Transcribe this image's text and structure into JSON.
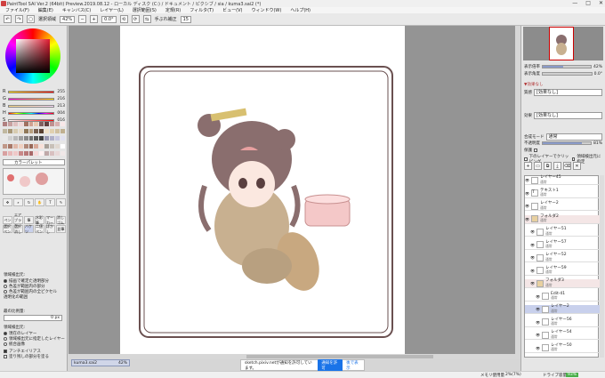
{
  "window": {
    "title": "PaintTool SAI Ver.2 (64bit) Preview.2019.08.12 - ローカル ディスク (C:) / ドキュメント / ピクシブ / sia / kuma3.sai2 (*)",
    "controls": [
      "—",
      "□",
      "✕"
    ]
  },
  "menu": [
    "ファイル(F)",
    "編集(E)",
    "キャンバス(C)",
    "レイヤー(L)",
    "選択範囲(S)",
    "定規(R)",
    "フィルタ(T)",
    "ビュー(V)",
    "ウィンドウ(W)",
    "ヘルプ(H)"
  ],
  "toolbar": {
    "selection_label": "選択領域",
    "zoom": "42%",
    "rotation": "0.0°",
    "stabilizer_label": "手ぶれ補正",
    "stabilizer_value": "15"
  },
  "color": {
    "hsv_labels": [
      "R",
      "G",
      "B",
      "H",
      "S",
      "V"
    ],
    "hsv_values": [
      "255",
      "216",
      "213",
      "004",
      "016",
      "100"
    ],
    "swatch_colors": [
      "#b08080",
      "#c8a0a0",
      "#e0c0c0",
      "#f0d8d8",
      "#a07060",
      "#d0a090",
      "#e8c8b0",
      "#806060",
      "#604040",
      "#c09090",
      "#d8b0b0",
      "#f8e8e8",
      "#c0b8a0",
      "#a89878",
      "#d8ccb0",
      "#e8dcc8",
      "#907858",
      "#b8a080",
      "#786050",
      "#584030",
      "#f0e0c8",
      "#e0d0b0",
      "#d0c0a0",
      "#c0b090",
      "#e8e8e8",
      "#d0d0d0",
      "#b8b8b8",
      "#a0a0a0",
      "#888888",
      "#707070",
      "#585858",
      "#404040",
      "#9898b0",
      "#b0b0c8",
      "#c8c8e0",
      "#e0e0f0",
      "#c09888",
      "#a87868",
      "#e0b8a8",
      "#f0d0c0",
      "#b08878",
      "#986858",
      "#d8a898",
      "#f8e0d8",
      "#a8a098",
      "#c8c0b8",
      "#e0d8d0",
      "#ffffff",
      "#d8a0a0",
      "#e8b8b8",
      "#f0c8c8",
      "#c88888",
      "#b87878",
      "#a86868",
      "#f8d8d8",
      "#fff0f0",
      "#c0a8a8",
      "#d8c0c0",
      "#e8d8d8",
      "#f0e8e8"
    ]
  },
  "tools": {
    "palette_mode": "カラーパレット",
    "brush_labels": [
      "ペン",
      "エアブラシ",
      "筆",
      "水彩筆",
      "マーカー",
      "消しゴム",
      "選択ペン",
      "選択消し",
      "バケツ",
      "二値ペン",
      "ぼかし",
      "鉛筆"
    ],
    "detect_label": "領域検出元:",
    "detect_options": [
      "描画で確定た透明部分",
      "色差が範囲内の部分",
      "色差が範囲内の全ピクセル"
    ],
    "detect_extra": "透明化の範囲",
    "spread_label": "最の比例量:",
    "spread_value": "0 px",
    "target_label": "領域検出元:",
    "target_options": [
      "現在のレイヤー",
      "領域検出元に指定したレイヤー",
      "統合画像"
    ],
    "aa_label": "アンチエイリアス",
    "aa_extra": "塗り残しの部分を塗る"
  },
  "statusbar": {
    "file_tab": "kuma3.sai2",
    "file_zoom": "42%",
    "notif_text": "sketch.pixiv.netが通知を許可しています。",
    "notif_allow": "通知を許可",
    "notif_later": "後で表示",
    "memory": "メモリ使用量",
    "memory_value": "2%(7%)",
    "drive": "ドライブ容量",
    "drive_value": "93%"
  },
  "right": {
    "zoom_label": "表示倍率",
    "zoom_value": "42%",
    "angle_label": "表示角度",
    "angle_value": "0.0°",
    "effect_header": "▼効果なし",
    "texture_label": "質感",
    "texture_value": "[効果なし]",
    "effect_label": "効果",
    "effect_value": "[効果なし]",
    "blend_label": "合成モード",
    "blend_value": "通常",
    "opacity_label": "不透明度",
    "opacity_value": "81%",
    "opacity_fraction": 0.81,
    "protect_label": "保護",
    "clip_label": "下のレイヤーでクリッピング",
    "ref_label": "領域検出元に指定",
    "navigator_zoom_fraction": 0.42
  },
  "layers": [
    {
      "name": "レイヤー45",
      "mode": "通常",
      "type": "layer"
    },
    {
      "name": "テキスト1",
      "mode": "通常",
      "type": "text"
    },
    {
      "name": "レイヤー2",
      "mode": "通常",
      "type": "layer"
    },
    {
      "name": "フォルダ2",
      "mode": "通常",
      "type": "folder"
    },
    {
      "name": "レイヤー51",
      "mode": "通常",
      "type": "layer"
    },
    {
      "name": "レイヤー57",
      "mode": "通常",
      "type": "layer"
    },
    {
      "name": "レイヤー52",
      "mode": "通常",
      "type": "layer"
    },
    {
      "name": "レイヤー59",
      "mode": "通常",
      "type": "layer"
    },
    {
      "name": "フォルダ3",
      "mode": "通常",
      "type": "folder"
    },
    {
      "name": "Edit-41",
      "mode": "通常",
      "type": "layer"
    },
    {
      "name": "レイヤー2",
      "mode": "通常",
      "type": "selected"
    },
    {
      "name": "レイヤー56",
      "mode": "通常",
      "type": "layer"
    },
    {
      "name": "レイヤー54",
      "mode": "通常",
      "type": "layer"
    },
    {
      "name": "レイヤー50",
      "mode": "通常",
      "type": "layer"
    }
  ]
}
